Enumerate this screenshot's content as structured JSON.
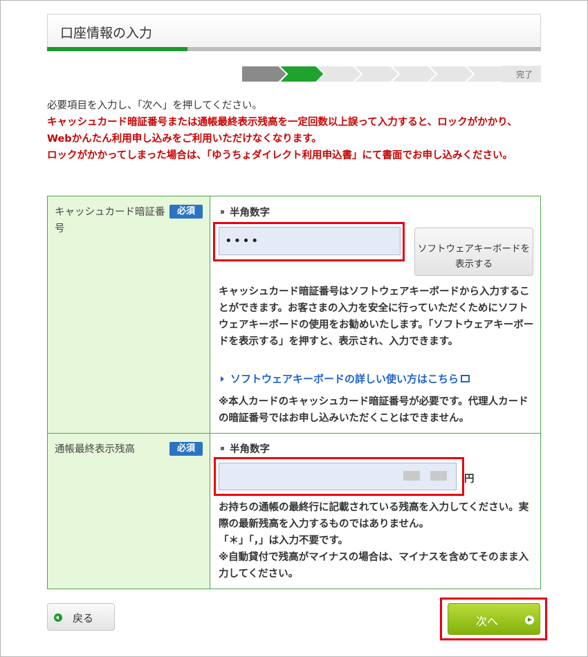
{
  "header": {
    "title": "口座情報の入力"
  },
  "progress": {
    "fraction": 0.285
  },
  "steps": {
    "total": 8,
    "current": 2,
    "final_label": "完了"
  },
  "intro": {
    "line": "必要項目を入力し、「次へ」を押してください。",
    "warning1": "キャッシュカード暗証番号または通帳最終表示残高を一定回数以上誤って入力すると、ロックがかかり、Webかんたん利用申し込みをご利用いただけなくなります。",
    "warning2": "ロックがかかってしまった場合は、「ゆうちょダイレクト利用申込書」にて書面でお申し込みください。"
  },
  "pin": {
    "label": "キャッシュカード暗証番号",
    "required": "必須",
    "format": "半角数字",
    "value": "••••",
    "softkey_button": "ソフトウェアキーボードを表示する",
    "desc": "キャッシュカード暗証番号はソフトウェアキーボードから入力することができます。お客さまの入力を安全に行っていただくためにソフトウェアキーボードの使用をお勧めいたします。「ソフトウェアキーボードを表示する」を押すと、表示され、入力できます。",
    "help_link": "ソフトウェアキーボードの詳しい使い方はこちら",
    "note": "※本人カードのキャッシュカード暗証番号が必要です。代理人カードの暗証番号ではお申し込みいただくことはできません。"
  },
  "balance": {
    "label": "通帳最終表示残高",
    "required": "必須",
    "format": "半角数字",
    "unit": "円",
    "desc": "お持ちの通帳の最終行に記載されている残高を入力してください。実際の最新残高を入力するものではありません。",
    "note1": "「＊」「，」は入力不要です。",
    "note2": "※自動貸付で残高がマイナスの場合は、マイナスを含めてそのまま入力してください。"
  },
  "buttons": {
    "back": "戻る",
    "next": "次へ"
  },
  "colors": {
    "accent_green": "#1a9a2a",
    "warning_red": "#cc0000",
    "link_blue": "#1f63c8",
    "badge_blue": "#2b74c4"
  }
}
